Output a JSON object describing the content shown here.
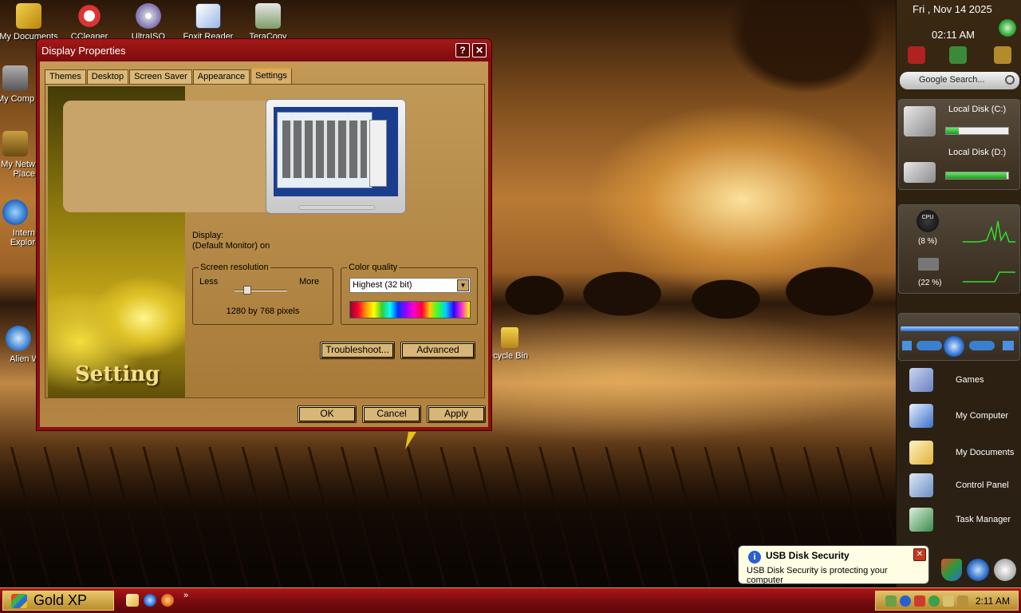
{
  "desktop": {
    "icons": [
      {
        "label": "My Documents"
      },
      {
        "label": "CCleaner"
      },
      {
        "label": "UltraISO"
      },
      {
        "label": "Foxit Reader"
      },
      {
        "label": "TeraCopy"
      },
      {
        "label": "My Comp"
      },
      {
        "label": "My Netw Place"
      },
      {
        "label": "Intern Explor"
      },
      {
        "label": "Alien W"
      },
      {
        "label": "ecycle Bin"
      }
    ]
  },
  "window": {
    "title": "Display Properties",
    "help_btn": "?",
    "close_btn": "✕",
    "tabs": [
      "Themes",
      "Desktop",
      "Screen Saver",
      "Appearance",
      "Settings"
    ],
    "active_tab": "Settings",
    "side_image_text": "Setting",
    "display_label": "Display:",
    "display_value": "(Default Monitor) on",
    "resolution": {
      "legend": "Screen resolution",
      "less": "Less",
      "more": "More",
      "value": "1280 by 768 pixels",
      "slider_position": 0.33
    },
    "color_quality": {
      "legend": "Color quality",
      "selected": "Highest (32 bit)",
      "arrow": "▼"
    },
    "buttons": {
      "troubleshoot": "Troubleshoot...",
      "advanced": "Advanced",
      "ok": "OK",
      "cancel": "Cancel",
      "apply": "Apply"
    }
  },
  "sidebar": {
    "date": "Fri , Nov 14 2025",
    "time": "02:11 AM",
    "search_placeholder": "Google Search...",
    "disks": [
      {
        "label": "Local Disk (C:)",
        "used_fraction": 0.2
      },
      {
        "label": "Local Disk (D:)",
        "used_fraction": 0.98
      }
    ],
    "cpu_label": "CPU",
    "cpu_percent": "(8 %)",
    "mem_percent": "(22 %)",
    "quick_links": [
      "Games",
      "My Computer",
      "My Documents",
      "Control Panel",
      "Task Manager"
    ]
  },
  "balloon": {
    "info_icon": "i",
    "title": "USB Disk Security",
    "body": "USB Disk Security is protecting your computer",
    "close": "✕"
  },
  "taskbar": {
    "start_label": "Gold XP",
    "more": "»",
    "clock": "2:11 AM"
  }
}
